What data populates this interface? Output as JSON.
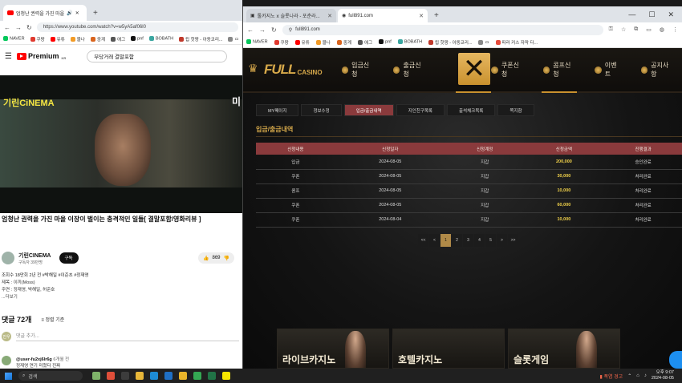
{
  "left_browser": {
    "tab_title": "엄청난 권력을 가진 마을",
    "url": "https://www.youtube.com/watch?v=w5yA5af06l0",
    "bookmarks": [
      "NAVER",
      "쿠팡",
      "유튜",
      "블나",
      "중계",
      "애그",
      "pnf",
      "BOBATH",
      "됩 핫팡 - 아동코리...",
      "ㅁ"
    ],
    "search_query": "부당거래 결말포함",
    "logo_text": "Premium",
    "logo_country": "KR",
    "video": {
      "brand_left": "기린CiNEMA",
      "brand_right": "미"
    },
    "video_title": "엄청난 권력을 가진 마을 이장이 벌이는 충격적인 일들[ 결말포함/영화리뷰 ]",
    "channel": {
      "name": "기린CINEMA",
      "subs": "구독자 39만명",
      "subscribe_label": "구독",
      "likes": "869"
    },
    "description": {
      "meta": "조회수 18만회 2년 전 #박해일 #이준초 #정재영",
      "line1": "제목 : 이끼(Moss)",
      "line2": "주연 : 정재영, 박해일, 허준호",
      "more": "...더보기"
    },
    "comments": {
      "count": "댓글 72개",
      "sort_label": "정렬 기준",
      "avatar_initial": "진우",
      "placeholder": "댓글 추가...",
      "first_user": "@user-fu2xj6lr6g",
      "first_time": "6개월 전",
      "first_text": "정재영 연기 미쳤다 진짜"
    }
  },
  "right_browser": {
    "tabs": [
      {
        "label": "툴카지노 ⅹ 슬롯나라 - 포춘라..."
      },
      {
        "label": "full891.com"
      }
    ],
    "url": "full891.com",
    "bookmarks": [
      "NAVER",
      "쿠팡",
      "유튜",
      "블나",
      "중계",
      "애그",
      "pnf",
      "BOBATH",
      "됩 핫팡 - 아동코리...",
      "ㅁ",
      "파라 커스 자막 다..."
    ],
    "logo_full": "FULL",
    "logo_casino": "CASINO",
    "nav": [
      "입금신청",
      "출금신청",
      "쿠폰신청",
      "콤프신청",
      "이벤트",
      "공지사항"
    ],
    "close_symbol": "✕",
    "subtabs": [
      "MY페이지",
      "정보수정",
      "입금/출금내역",
      "지인친구목록",
      "출석체크목록",
      "쪽지함"
    ],
    "active_subtab_index": 2,
    "section_title": "입금/출금내역",
    "table": {
      "headers": [
        "신청내용",
        "신청일자",
        "신청계정",
        "신청금액",
        "진행결과"
      ],
      "rows": [
        [
          "입금",
          "2024-08-05",
          "지갑",
          "200,000",
          "승인완료"
        ],
        [
          "쿠폰",
          "2024-08-05",
          "지갑",
          "30,000",
          "처리완료"
        ],
        [
          "콤프",
          "2024-08-05",
          "지갑",
          "10,000",
          "처리완료"
        ],
        [
          "쿠폰",
          "2024-08-05",
          "지갑",
          "60,000",
          "처리완료"
        ],
        [
          "쿠폰",
          "2024-08-04",
          "지갑",
          "10,000",
          "처리완료"
        ]
      ]
    },
    "pager": [
      "<<",
      "<",
      "1",
      "2",
      "3",
      "4",
      "5",
      ">",
      ">>"
    ],
    "current_page": "1",
    "banners": [
      "라이브카지노",
      "호텔카지노",
      "슬롯게임"
    ]
  },
  "taskbar": {
    "search_label": "검색",
    "weather": "폭염 경고",
    "time": "오후 9:07",
    "date": "2024-08-05"
  },
  "colors": {
    "accent_gold": "#d3a74a",
    "accent_red": "#8a3a3c",
    "amount_yellow": "#f0d14a"
  }
}
